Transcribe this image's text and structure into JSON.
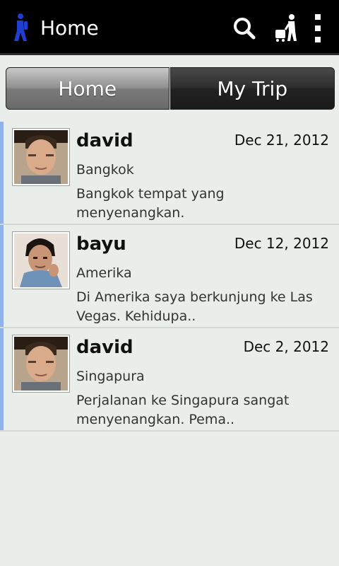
{
  "action_bar": {
    "title": "Home",
    "actions": [
      "search-icon",
      "traveler-icon",
      "overflow-menu-icon"
    ]
  },
  "tabs": [
    {
      "label": "Home",
      "selected": false
    },
    {
      "label": "My Trip",
      "selected": true
    }
  ],
  "colors": {
    "accent": "#8fb2ea",
    "app_icon": "#1f3fd1",
    "background": "#e9eeea"
  },
  "posts": [
    {
      "name": "david",
      "date": "Dec 21, 2012",
      "place": "Bangkok",
      "text": "Bangkok tempat yang menyenangkan.",
      "avatar": "david"
    },
    {
      "name": "bayu",
      "date": "Dec 12, 2012",
      "place": "Amerika",
      "text": "Di Amerika saya berkunjung ke Las Vegas. Kehidupa..",
      "avatar": "bayu"
    },
    {
      "name": "david",
      "date": "Dec 2, 2012",
      "place": "Singapura",
      "text": "Perjalanan ke Singapura sangat menyenangkan. Pema..",
      "avatar": "david"
    }
  ]
}
